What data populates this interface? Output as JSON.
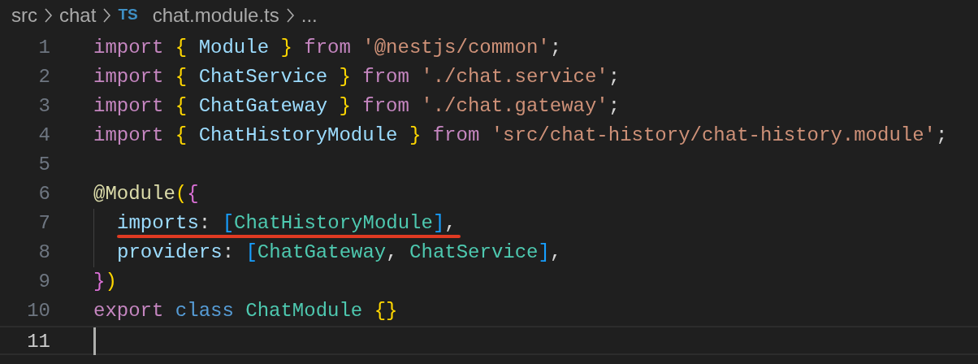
{
  "breadcrumb": [
    {
      "kind": "folder",
      "text": "src"
    },
    {
      "kind": "folder",
      "text": "chat"
    },
    {
      "kind": "file",
      "badge": "TS",
      "text": "chat.module.ts"
    },
    {
      "kind": "more",
      "text": "..."
    }
  ],
  "lines": [
    {
      "number": "1",
      "current": false,
      "underlined": false,
      "indented": false,
      "tokens": [
        {
          "kind": "keyword",
          "text": "import "
        },
        {
          "kind": "brace",
          "text": "{"
        },
        {
          "kind": "ident",
          "text": " Module "
        },
        {
          "kind": "brace",
          "text": "}"
        },
        {
          "kind": "keyword",
          "text": " from "
        },
        {
          "kind": "string",
          "text": "'@nestjs/common'"
        },
        {
          "kind": "plain",
          "text": ";"
        }
      ]
    },
    {
      "number": "2",
      "current": false,
      "underlined": false,
      "indented": false,
      "tokens": [
        {
          "kind": "keyword",
          "text": "import "
        },
        {
          "kind": "brace",
          "text": "{"
        },
        {
          "kind": "ident",
          "text": " ChatService "
        },
        {
          "kind": "brace",
          "text": "}"
        },
        {
          "kind": "keyword",
          "text": " from "
        },
        {
          "kind": "string",
          "text": "'./chat.service'"
        },
        {
          "kind": "plain",
          "text": ";"
        }
      ]
    },
    {
      "number": "3",
      "current": false,
      "underlined": false,
      "indented": false,
      "tokens": [
        {
          "kind": "keyword",
          "text": "import "
        },
        {
          "kind": "brace",
          "text": "{"
        },
        {
          "kind": "ident",
          "text": " ChatGateway "
        },
        {
          "kind": "brace",
          "text": "}"
        },
        {
          "kind": "keyword",
          "text": " from "
        },
        {
          "kind": "string",
          "text": "'./chat.gateway'"
        },
        {
          "kind": "plain",
          "text": ";"
        }
      ]
    },
    {
      "number": "4",
      "current": false,
      "underlined": false,
      "indented": false,
      "tokens": [
        {
          "kind": "keyword",
          "text": "import "
        },
        {
          "kind": "brace",
          "text": "{"
        },
        {
          "kind": "ident",
          "text": " ChatHistoryModule "
        },
        {
          "kind": "brace",
          "text": "}"
        },
        {
          "kind": "keyword",
          "text": " from "
        },
        {
          "kind": "string",
          "text": "'src/chat-history/chat-history.module'"
        },
        {
          "kind": "plain",
          "text": ";"
        }
      ]
    },
    {
      "number": "5",
      "current": false,
      "underlined": false,
      "indented": false
    },
    {
      "number": "6",
      "current": false,
      "underlined": false,
      "indented": false,
      "tokens": [
        {
          "kind": "decorator",
          "text": "@Module"
        },
        {
          "kind": "brace",
          "text": "("
        },
        {
          "kind": "brace2",
          "text": "{"
        }
      ]
    },
    {
      "number": "7",
      "current": false,
      "underlined": true,
      "indented": true,
      "tokens": [
        {
          "kind": "ident",
          "text": "imports"
        },
        {
          "kind": "plain",
          "text": ": "
        },
        {
          "kind": "bracket",
          "text": "["
        },
        {
          "kind": "classname",
          "text": "ChatHistoryModule"
        },
        {
          "kind": "bracket",
          "text": "]"
        },
        {
          "kind": "plain",
          "text": ","
        }
      ]
    },
    {
      "number": "8",
      "current": false,
      "underlined": false,
      "indented": true,
      "tokens": [
        {
          "kind": "ident",
          "text": "providers"
        },
        {
          "kind": "plain",
          "text": ": "
        },
        {
          "kind": "bracket",
          "text": "["
        },
        {
          "kind": "classname",
          "text": "ChatGateway"
        },
        {
          "kind": "plain",
          "text": ", "
        },
        {
          "kind": "classname",
          "text": "ChatService"
        },
        {
          "kind": "bracket",
          "text": "]"
        },
        {
          "kind": "plain",
          "text": ","
        }
      ]
    },
    {
      "number": "9",
      "current": false,
      "underlined": false,
      "indented": false,
      "tokens": [
        {
          "kind": "brace2",
          "text": "}"
        },
        {
          "kind": "brace",
          "text": ")"
        }
      ]
    },
    {
      "number": "10",
      "current": false,
      "underlined": false,
      "indented": false,
      "tokens": [
        {
          "kind": "keyword",
          "text": "export "
        },
        {
          "kind": "storage",
          "text": "class "
        },
        {
          "kind": "classname",
          "text": "ChatModule "
        },
        {
          "kind": "brace",
          "text": "{}"
        }
      ]
    },
    {
      "number": "11",
      "current": true,
      "underlined": false,
      "indented": false
    }
  ]
}
